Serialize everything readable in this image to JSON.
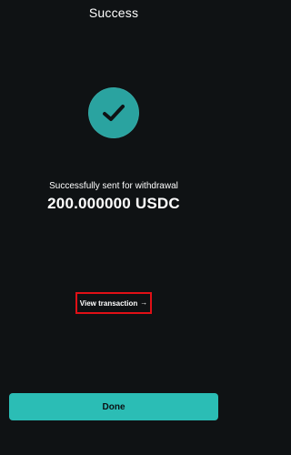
{
  "header": {
    "title": "Success"
  },
  "status": {
    "icon": "checkmark-icon",
    "message": "Successfully sent for withdrawal",
    "amount": "200.000000 USDC"
  },
  "actions": {
    "view_transaction_label": "View transaction",
    "view_transaction_icon": "arrow-right-icon",
    "done_label": "Done"
  },
  "colors": {
    "background": "#0f1214",
    "accent": "#2bbdb5",
    "icon_background": "#2aa3a0",
    "highlight_border": "#e01016"
  }
}
